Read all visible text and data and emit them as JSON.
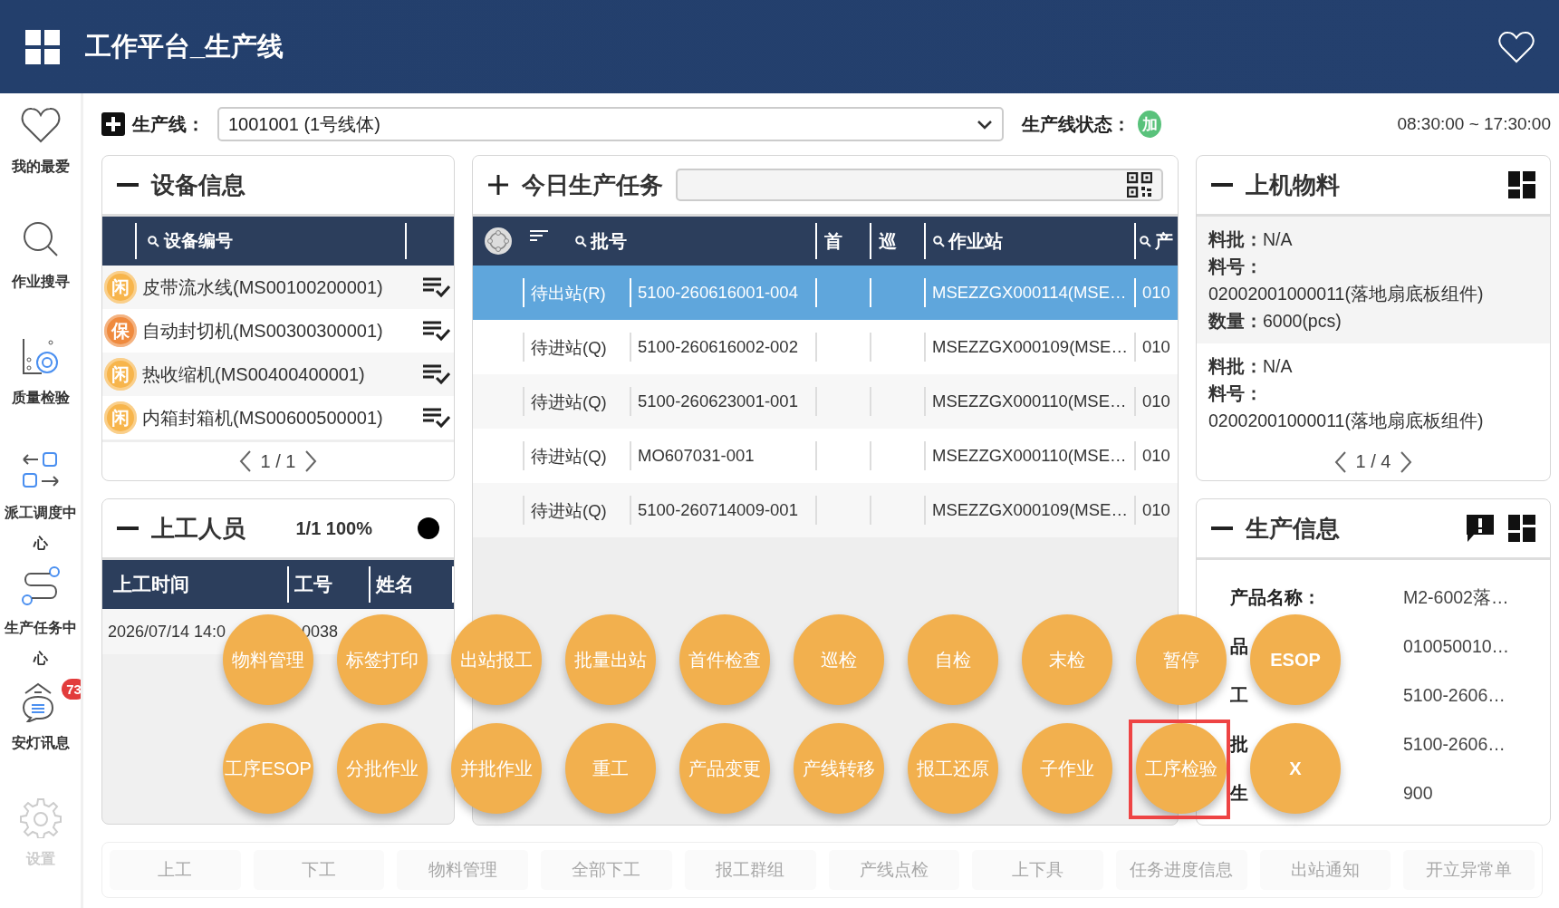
{
  "header": {
    "title": "工作平台_生产线"
  },
  "sidebar": {
    "items": [
      {
        "label": "我的最爱",
        "kind": "heart",
        "disabled": false
      },
      {
        "label": "作业搜寻",
        "kind": "search",
        "disabled": false
      },
      {
        "label": "质量检验",
        "kind": "quality",
        "disabled": false
      },
      {
        "label": "派工调度中心",
        "kind": "dispatch",
        "disabled": false
      },
      {
        "label": "生产任务中心",
        "kind": "route",
        "disabled": false
      },
      {
        "label": "安灯讯息",
        "kind": "andon",
        "badge": "73",
        "disabled": false
      },
      {
        "label": "设置",
        "kind": "gear",
        "disabled": true
      }
    ]
  },
  "toolbar": {
    "line_label": "生产线：",
    "line_value": "1001001 (1号线体)",
    "status_label": "生产线状态：",
    "status_badge": "加",
    "shift_time": "08:30:00 ~ 17:30:00"
  },
  "equipment": {
    "title": "设备信息",
    "column": "设备编号",
    "rows": [
      {
        "status": "闲",
        "color": "#f7b54c",
        "name": "皮带流水线(MS00100200001)"
      },
      {
        "status": "保",
        "color": "#ef8a3e",
        "name": "自动封切机(MS00300300001)"
      },
      {
        "status": "闲",
        "color": "#f7b54c",
        "name": "热收缩机(MS00400400001)"
      },
      {
        "status": "闲",
        "color": "#f7b54c",
        "name": "内箱封箱机(MS00600500001)"
      }
    ],
    "pager": "1 / 1"
  },
  "workers": {
    "title": "上工人员",
    "summary": "1/1 100%",
    "columns": [
      "上工时间",
      "工号",
      "姓名"
    ],
    "rows": [
      {
        "time": "2026/07/14 14:0",
        "id": "0038"
      }
    ]
  },
  "tasks": {
    "title": "今日生产任务",
    "columns": [
      "批号",
      "首",
      "巡",
      "作业站",
      "产"
    ],
    "rows": [
      {
        "selected": true,
        "status": "待出站(R)",
        "lot": "5100-260616001-004",
        "station": "MSEZZGX000114(MSE…",
        "column_7": "010"
      },
      {
        "selected": false,
        "status": "待进站(Q)",
        "lot": "5100-260616002-002",
        "station": "MSEZZGX000109(MSE…",
        "column_7": "010"
      },
      {
        "selected": false,
        "status": "待进站(Q)",
        "lot": "5100-260623001-001",
        "station": "MSEZZGX000110(MSE…",
        "column_7": "010"
      },
      {
        "selected": false,
        "status": "待进站(Q)",
        "lot": "MO607031-001",
        "station": "MSEZZGX000110(MSE…",
        "column_7": "010"
      },
      {
        "selected": false,
        "status": "待进站(Q)",
        "lot": "5100-260714009-001",
        "station": "MSEZZGX000109(MSE…",
        "column_7": "010"
      }
    ]
  },
  "materials": {
    "title": "上机物料",
    "cards": [
      {
        "fields": [
          {
            "label": "料批：",
            "value": "N/A"
          },
          {
            "label": "料号："
          },
          {
            "value": "02002001000011(落地扇底板组件)"
          },
          {
            "label": "数量：",
            "value": "6000(pcs)"
          }
        ]
      },
      {
        "fields": [
          {
            "label": "料批：",
            "value": "N/A"
          },
          {
            "label": "料号："
          },
          {
            "value": "02002001000011(落地扇底板组件)"
          }
        ]
      }
    ],
    "pager": "1 / 4"
  },
  "production": {
    "title": "生产信息",
    "rows": [
      {
        "label": "产品名称：",
        "value": "M2-6002落…"
      },
      {
        "label": "品",
        "value": "010050010…"
      },
      {
        "label": "工",
        "value": "5100-2606…"
      },
      {
        "label": "批",
        "value": "5100-2606…"
      },
      {
        "label": "生",
        "value": "900"
      }
    ]
  },
  "actions": [
    {
      "label": "物料管理",
      "highlighted": false
    },
    {
      "label": "标签打印",
      "highlighted": false
    },
    {
      "label": "出站报工",
      "highlighted": false
    },
    {
      "label": "批量出站",
      "highlighted": false
    },
    {
      "label": "首件检查",
      "highlighted": false
    },
    {
      "label": "巡检",
      "highlighted": false
    },
    {
      "label": "自检",
      "highlighted": false
    },
    {
      "label": "末检",
      "highlighted": false
    },
    {
      "label": "暂停",
      "highlighted": false
    },
    {
      "label": "ESOP",
      "highlighted": false
    },
    {
      "label": "工序ESOP",
      "highlighted": false
    },
    {
      "label": "分批作业",
      "highlighted": false
    },
    {
      "label": "并批作业",
      "highlighted": false
    },
    {
      "label": "重工",
      "highlighted": false
    },
    {
      "label": "产品变更",
      "highlighted": false
    },
    {
      "label": "产线转移",
      "highlighted": false
    },
    {
      "label": "报工还原",
      "highlighted": false
    },
    {
      "label": "子作业",
      "highlighted": false
    },
    {
      "label": "工序检验",
      "highlighted": true
    },
    {
      "label": "X",
      "highlighted": false
    }
  ],
  "bottom_bar": {
    "buttons": [
      {
        "label": "上工",
        "disabled": true
      },
      {
        "label": "下工",
        "disabled": true
      },
      {
        "label": "物料管理",
        "disabled": true
      },
      {
        "label": "全部下工",
        "disabled": true
      },
      {
        "label": "报工群组",
        "disabled": true
      },
      {
        "label": "产线点检",
        "disabled": true
      },
      {
        "label": "上下具",
        "disabled": true
      },
      {
        "label": "任务进度信息",
        "disabled": true
      },
      {
        "label": "出站通知",
        "disabled": true
      },
      {
        "label": "开立异常单",
        "disabled": true
      }
    ]
  }
}
